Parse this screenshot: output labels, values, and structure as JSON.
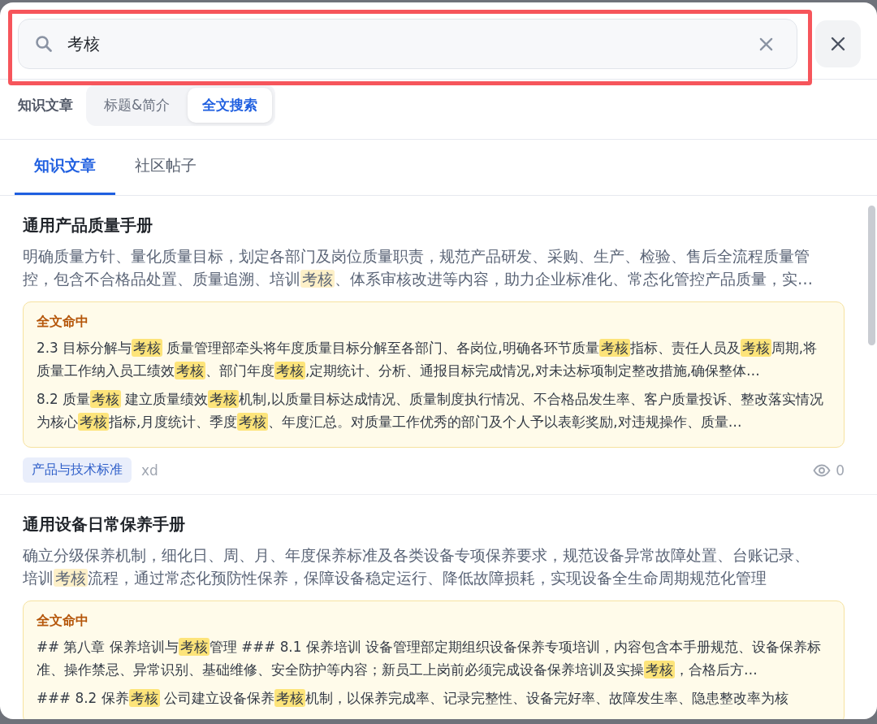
{
  "search": {
    "value": "考核",
    "framed": true
  },
  "filter": {
    "label": "知识文章",
    "options": [
      {
        "label": "标题&简介",
        "selected": false
      },
      {
        "label": "全文搜索",
        "selected": true
      }
    ]
  },
  "tabs": [
    {
      "label": "知识文章",
      "selected": true
    },
    {
      "label": "社区帖子",
      "selected": false
    }
  ],
  "results": [
    {
      "title": "通用产品质量手册",
      "description": [
        {
          "text": "明确质量方针、量化质量目标，划定各部门及岗位质量职责，规范产品研发、采购、生产、检验、售后全流程质量管控，包含不合格品处置、质量追溯、培训",
          "highlighted": false
        },
        {
          "text": "考核",
          "highlighted": true
        },
        {
          "text": "、体系审核改进等内容，助力企业标准化、常态化管控产品质量，实…",
          "highlighted": false
        }
      ],
      "hits": {
        "label": "全文命中",
        "snippets": [
          [
            {
              "text": "2.3 目标分解与",
              "highlighted": false
            },
            {
              "text": "考核",
              "highlighted": true
            },
            {
              "text": " 质量管理部牵头将年度质量目标分解至各部门、各岗位,明确各环节质量",
              "highlighted": false
            },
            {
              "text": "考核",
              "highlighted": true
            },
            {
              "text": "指标、责任人员及",
              "highlighted": false
            },
            {
              "text": "考核",
              "highlighted": true
            },
            {
              "text": "周期,将质量工作纳入员工绩效",
              "highlighted": false
            },
            {
              "text": "考核",
              "highlighted": true
            },
            {
              "text": "、部门年度",
              "highlighted": false
            },
            {
              "text": "考核",
              "highlighted": true
            },
            {
              "text": ",定期统计、分析、通报目标完成情况,对未达标项制定整改措施,确保整体…",
              "highlighted": false
            }
          ],
          [
            {
              "text": "8.2 质量",
              "highlighted": false
            },
            {
              "text": "考核",
              "highlighted": true
            },
            {
              "text": " 建立质量绩效",
              "highlighted": false
            },
            {
              "text": "考核",
              "highlighted": true
            },
            {
              "text": "机制,以质量目标达成情况、质量制度执行情况、不合格品发生率、客户质量投诉、整改落实情况为核心",
              "highlighted": false
            },
            {
              "text": "考核",
              "highlighted": true
            },
            {
              "text": "指标,月度统计、季度",
              "highlighted": false
            },
            {
              "text": "考核",
              "highlighted": true
            },
            {
              "text": "、年度汇总。对质量工作优秀的部门及个人予以表彰奖励,对违规操作、质量…",
              "highlighted": false
            }
          ]
        ]
      },
      "tag": "产品与技术标准",
      "author": "xd",
      "views": "0"
    },
    {
      "title": "通用设备日常保养手册",
      "description": [
        {
          "text": "确立分级保养机制，细化日、周、月、年度保养标准及各类设备专项保养要求，规范设备异常故障处置、台账记录、培训",
          "highlighted": false
        },
        {
          "text": "考核",
          "highlighted": true
        },
        {
          "text": "流程，通过常态化预防性保养，保障设备稳定运行、降低故障损耗，实现设备全生命周期规范化管理",
          "highlighted": false
        }
      ],
      "hits": {
        "label": "全文命中",
        "snippets": [
          [
            {
              "text": "## 第八章 保养培训与",
              "highlighted": false
            },
            {
              "text": "考核",
              "highlighted": true
            },
            {
              "text": "管理 ### 8.1 保养培训 设备管理部定期组织设备保养专项培训，内容包含本手册规范、设备保养标准、操作禁忌、异常识别、基础维修、安全防护等内容；新员工上岗前必须完成设备保养培训及实操",
              "highlighted": false
            },
            {
              "text": "考核",
              "highlighted": true
            },
            {
              "text": "，合格后方…",
              "highlighted": false
            }
          ],
          [
            {
              "text": "### 8.2 保养",
              "highlighted": false
            },
            {
              "text": "考核",
              "highlighted": true
            },
            {
              "text": " 公司建立设备保养",
              "highlighted": false
            },
            {
              "text": "考核",
              "highlighted": true
            },
            {
              "text": "机制，以保养完成率、记录完整性、设备完好率、故障发生率、隐患整改率为核",
              "highlighted": false
            }
          ]
        ]
      }
    }
  ]
}
